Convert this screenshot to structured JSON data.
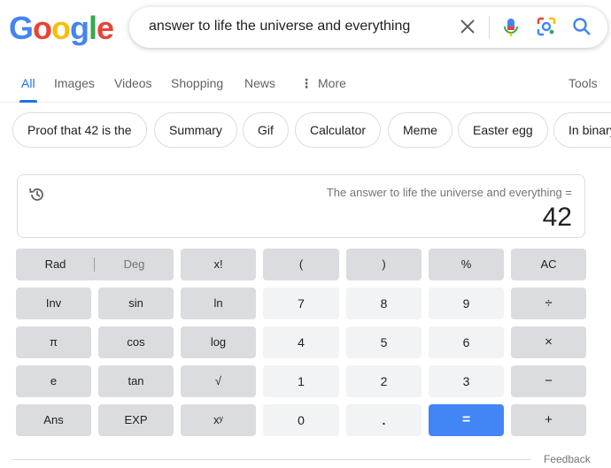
{
  "logo": {
    "letters": [
      "G",
      "o",
      "o",
      "g",
      "l",
      "e"
    ],
    "colors": [
      "#4285f4",
      "#ea4335",
      "#fbbc05",
      "#4285f4",
      "#34a853",
      "#ea4335"
    ]
  },
  "search": {
    "query": "answer to life the universe and everything"
  },
  "tabs": [
    {
      "label": "All"
    },
    {
      "label": "Images"
    },
    {
      "label": "Videos"
    },
    {
      "label": "Shopping"
    },
    {
      "label": "News"
    },
    {
      "label": "More"
    },
    {
      "label": "Tools"
    }
  ],
  "chips": [
    "Proof that 42 is the",
    "Summary",
    "Gif",
    "Calculator",
    "Meme",
    "Easter egg",
    "In binary"
  ],
  "calculator": {
    "expression": "The answer to life the universe and everything =",
    "result": "42",
    "rad_label": "Rad",
    "deg_label": "Deg",
    "keys": [
      [
        "x!",
        "(",
        ")",
        "%",
        "AC"
      ],
      [
        "Inv",
        "sin",
        "ln",
        "7",
        "8",
        "9",
        "÷"
      ],
      [
        "π",
        "cos",
        "log",
        "4",
        "5",
        "6",
        "×"
      ],
      [
        "e",
        "tan",
        "√",
        "1",
        "2",
        "3",
        "−"
      ],
      [
        "Ans",
        "EXP",
        "xʸ",
        "0",
        ".",
        "=",
        "+"
      ]
    ]
  },
  "feedback": "Feedback",
  "colors": {
    "accent": "#1a73e8",
    "equals": "#4285f4"
  }
}
